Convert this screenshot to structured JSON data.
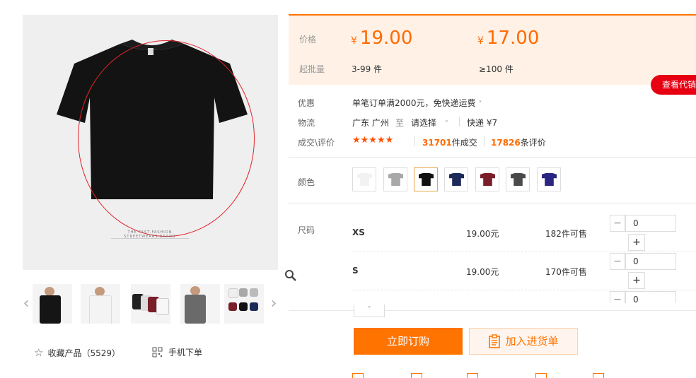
{
  "gallery": {
    "brand_caption": "THE FAST-FASHION STREETWEARS BRAND",
    "favorite_label": "收藏产品（5529）",
    "mobile_label": "手机下单",
    "thumbnail_count": 5
  },
  "price": {
    "price_label": "价格",
    "batch_label": "起批量",
    "tier1_currency": "¥",
    "tier1_price": "19.00",
    "tier1_range": "3-99 件",
    "tier2_currency": "¥",
    "tier2_price": "17.00",
    "tier2_range": "≥100 件",
    "agent_button": "查看代销"
  },
  "info": {
    "promo_label": "优惠",
    "promo_text": "单笔订单满2000元，免快递运费",
    "logistics_label": "物流",
    "from_location": "广东 广州",
    "to_word": "至",
    "destination": "请选择",
    "shipping": "快递 ¥7",
    "deals_label": "成交\\评价",
    "stars": "★★★★★",
    "deal_count": "31701",
    "deal_unit": "件成交",
    "review_count": "17826",
    "review_unit": "条评价"
  },
  "color": {
    "label": "颜色",
    "swatches": [
      {
        "name": "white",
        "hex": "#f2f2f2",
        "selected": false
      },
      {
        "name": "gray",
        "hex": "#a8a8a8",
        "selected": false
      },
      {
        "name": "black",
        "hex": "#111111",
        "selected": true
      },
      {
        "name": "navy",
        "hex": "#1c2a5a",
        "selected": false
      },
      {
        "name": "burgundy",
        "hex": "#7a1e2a",
        "selected": false
      },
      {
        "name": "charcoal",
        "hex": "#4a4a4a",
        "selected": false
      },
      {
        "name": "royal-blue",
        "hex": "#2a2580",
        "selected": false
      }
    ]
  },
  "sizes": {
    "label": "尺码",
    "rows": [
      {
        "name": "XS",
        "price": "19.00元",
        "stock": "182件可售",
        "qty": "0"
      },
      {
        "name": "S",
        "price": "19.00元",
        "stock": "170件可售",
        "qty": "0"
      },
      {
        "name": "",
        "price": "",
        "stock": "",
        "qty": "0"
      }
    ]
  },
  "actions": {
    "order_button": "立即订购",
    "cart_button": "加入进货单"
  },
  "colors": {
    "accent": "#ff7300",
    "price": "#ff6a00",
    "agent": "#e60012"
  }
}
